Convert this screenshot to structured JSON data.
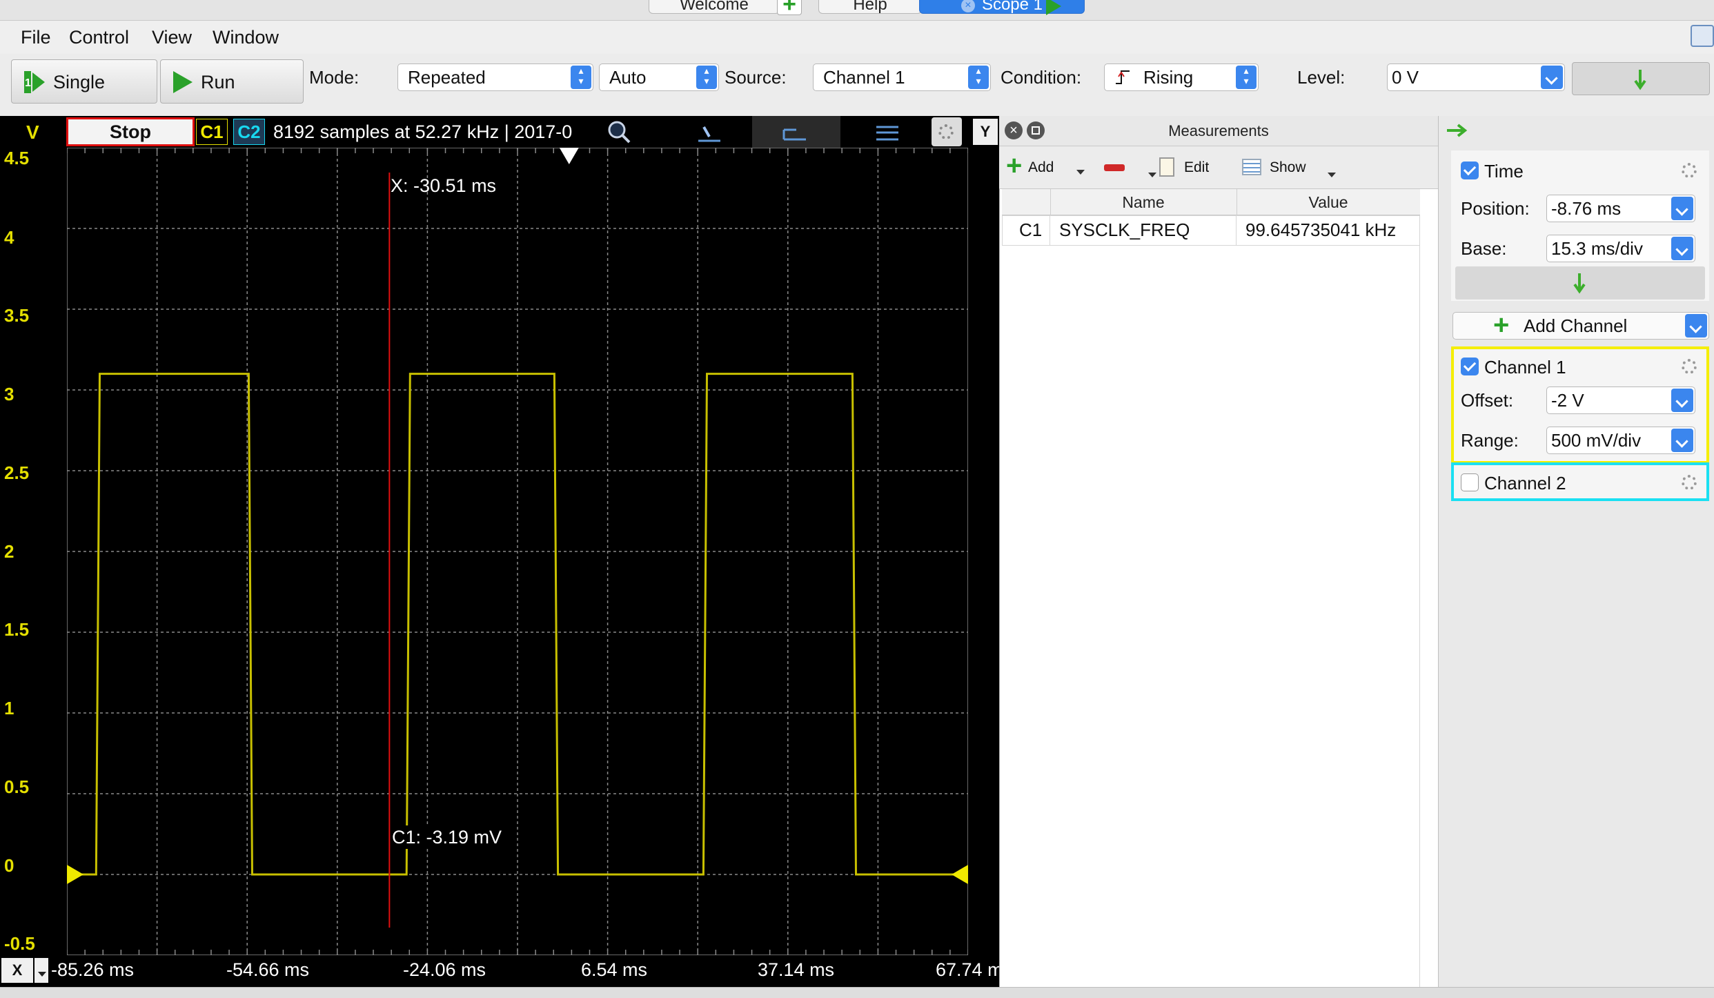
{
  "tabs": [
    {
      "label": "Welcome",
      "active": false
    },
    {
      "label": "Help",
      "active": false
    },
    {
      "label": "Scope 1",
      "active": true
    }
  ],
  "menu": [
    "File",
    "Control",
    "View",
    "Window"
  ],
  "toolbar": {
    "single_label": "Single",
    "run_label": "Run",
    "mode_label": "Mode:",
    "mode_value": "Repeated",
    "trigger_mode_value": "Auto",
    "source_label": "Source:",
    "source_value": "Channel 1",
    "condition_label": "Condition:",
    "condition_value": "Rising",
    "level_label": "Level:",
    "level_value": "0 V"
  },
  "scope": {
    "unit_label": "V",
    "stop_label": "Stop",
    "c1_label": "C1",
    "c2_label": "C2",
    "info": "8192 samples at 52.27 kHz | 2017-0",
    "y_axis_button": "Y",
    "x_axis_button": "X",
    "cursor_x_label": "X: -30.51 ms",
    "cursor_y_label": "C1: -3.19 mV",
    "colors": {
      "trace": "#c8c000",
      "cursor": "#e01010",
      "grid": "#8a8a8a",
      "c1": "#f0ea00",
      "c2": "#18d8f0"
    }
  },
  "chart_data": {
    "type": "line",
    "title": "",
    "xlabel": "",
    "ylabel": "V",
    "y_ticks": [
      "4.5",
      "4",
      "3.5",
      "3",
      "2.5",
      "2",
      "1.5",
      "1",
      "0.5",
      "0",
      "-0.5"
    ],
    "x_ticks": [
      "-85.26 ms",
      "-54.66 ms",
      "-24.06 ms",
      "6.54 ms",
      "37.14 ms",
      "67.74 m"
    ],
    "xlim": [
      -85.26,
      67.74
    ],
    "ylim": [
      -0.5,
      4.5
    ],
    "grid": true,
    "series": [
      {
        "name": "C1",
        "x": [
          -85.26,
          -80.3,
          -79.7,
          -54.4,
          -53.8,
          -27.6,
          -27.0,
          -2.5,
          -1.9,
          22.8,
          23.4,
          48.1,
          48.7,
          67.74
        ],
        "y": [
          0,
          0,
          3.1,
          3.1,
          0,
          0,
          3.1,
          3.1,
          0,
          0,
          3.1,
          3.1,
          0,
          0
        ]
      }
    ],
    "cursor_x_ms": -30.51,
    "cursor_y_mV": -3.19
  },
  "measurements": {
    "title": "Measurements",
    "toolbar": {
      "add": "Add",
      "edit": "Edit",
      "show": "Show"
    },
    "columns": [
      "Name",
      "Value"
    ],
    "rows": [
      {
        "channel": "C1",
        "name": "SYSCLK_FREQ",
        "value": "99.645735041 kHz"
      }
    ]
  },
  "right_panel": {
    "time": {
      "label": "Time",
      "position_label": "Position:",
      "position_value": "-8.76 ms",
      "base_label": "Base:",
      "base_value": "15.3 ms/div"
    },
    "add_channel_label": "Add Channel",
    "channel1": {
      "label": "Channel 1",
      "offset_label": "Offset:",
      "offset_value": "-2 V",
      "range_label": "Range:",
      "range_value": "500 mV/div",
      "color": "#f5ee00"
    },
    "channel2": {
      "label": "Channel 2",
      "color": "#1ae0f2"
    }
  }
}
